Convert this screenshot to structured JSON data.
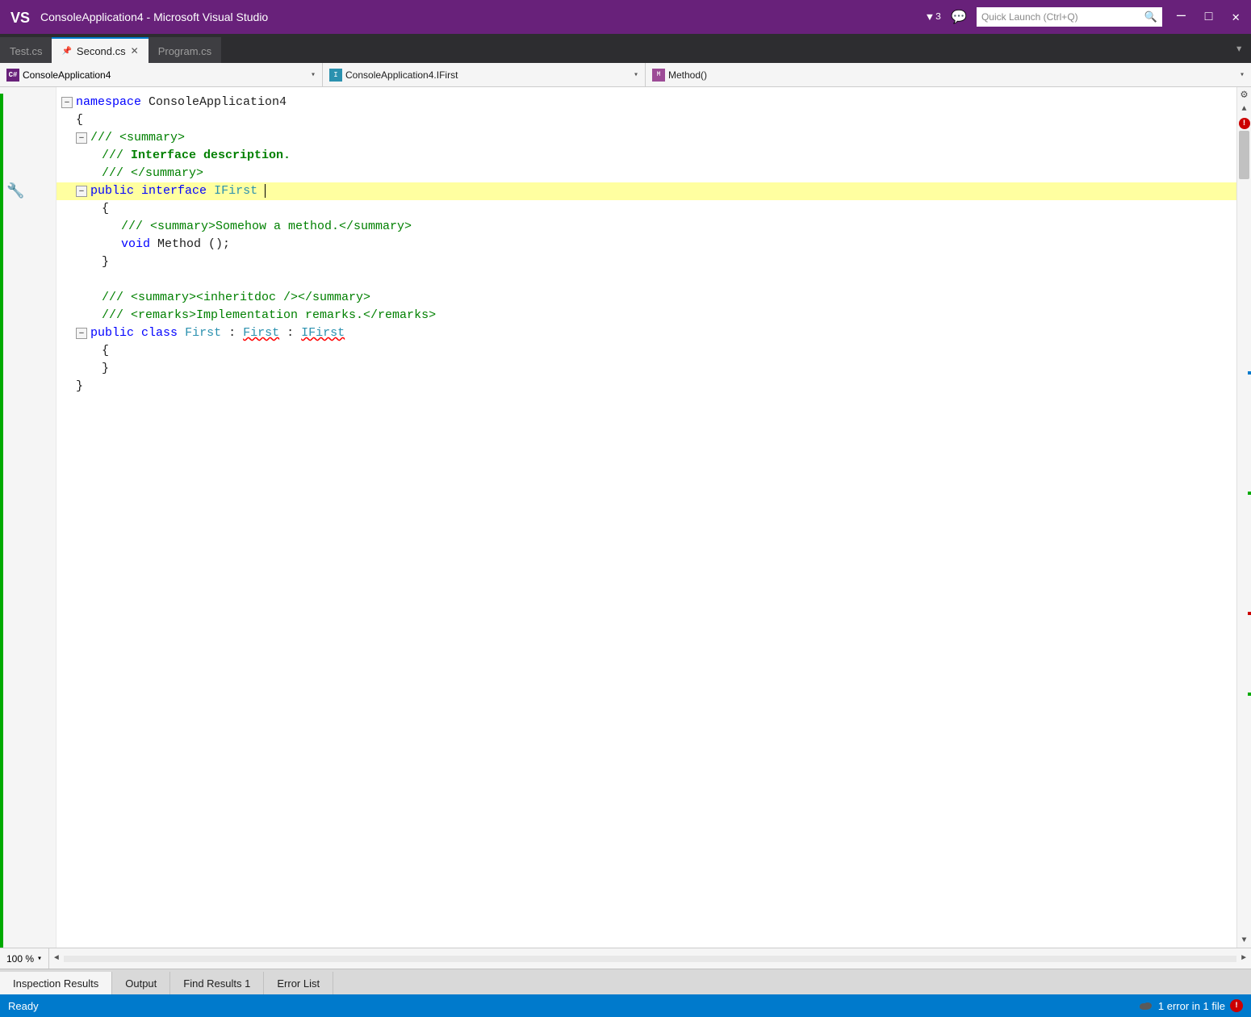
{
  "titlebar": {
    "title": "ConsoleApplication4 - Microsoft Visual Studio",
    "filter_count": "3",
    "search_placeholder": "Quick Launch (Ctrl+Q)"
  },
  "tabs": [
    {
      "label": "Test.cs",
      "active": false,
      "pinned": false,
      "closeable": false
    },
    {
      "label": "Second.cs",
      "active": true,
      "pinned": true,
      "closeable": true
    },
    {
      "label": "Program.cs",
      "active": false,
      "pinned": false,
      "closeable": false
    }
  ],
  "navbar": {
    "project": "ConsoleApplication4",
    "class": "ConsoleApplication4.IFirst",
    "member": "Method()"
  },
  "code": {
    "lines": [
      {
        "num": "",
        "indent": 0,
        "content": "namespace ConsoleApplication4",
        "type": "namespace"
      },
      {
        "num": "",
        "indent": 0,
        "content": "{",
        "type": "plain"
      },
      {
        "num": "",
        "indent": 1,
        "content": "/// <summary>",
        "type": "comment"
      },
      {
        "num": "",
        "indent": 1,
        "content": "/// Interface description.",
        "type": "comment"
      },
      {
        "num": "",
        "indent": 1,
        "content": "/// </summary>",
        "type": "comment"
      },
      {
        "num": "",
        "indent": 1,
        "content": "public interface IFirst",
        "type": "interface",
        "highlight": true
      },
      {
        "num": "",
        "indent": 1,
        "content": "{",
        "type": "plain"
      },
      {
        "num": "",
        "indent": 2,
        "content": "/// <summary>Somehow a method.</summary>",
        "type": "comment"
      },
      {
        "num": "",
        "indent": 2,
        "content": "void Method ();",
        "type": "method"
      },
      {
        "num": "",
        "indent": 1,
        "content": "}",
        "type": "plain"
      },
      {
        "num": "",
        "indent": 0,
        "content": "",
        "type": "plain"
      },
      {
        "num": "",
        "indent": 1,
        "content": "/// <summary><inheritdoc /></summary>",
        "type": "comment"
      },
      {
        "num": "",
        "indent": 1,
        "content": "/// <remarks>Implementation remarks.</remarks>",
        "type": "comment"
      },
      {
        "num": "",
        "indent": 1,
        "content": "public class First : IFirst",
        "type": "class"
      },
      {
        "num": "",
        "indent": 1,
        "content": "{",
        "type": "plain"
      },
      {
        "num": "",
        "indent": 1,
        "content": "}",
        "type": "plain"
      },
      {
        "num": "",
        "indent": 0,
        "content": "}",
        "type": "plain"
      }
    ]
  },
  "bottom_bar": {
    "zoom": "100 %"
  },
  "panel_tabs": [
    {
      "label": "Inspection Results",
      "active": true
    },
    {
      "label": "Output",
      "active": false
    },
    {
      "label": "Find Results 1",
      "active": false
    },
    {
      "label": "Error List",
      "active": false
    }
  ],
  "status_bar": {
    "ready": "Ready",
    "error_text": "1 error in 1 file"
  },
  "icons": {
    "vs_logo": "VS",
    "filter": "▼",
    "chat": "💬",
    "search": "🔍",
    "minimize": "─",
    "maximize": "□",
    "close": "✕",
    "collapse": "─",
    "expand": "+",
    "dropdown": "▾",
    "scroll_up": "▲",
    "scroll_down": "▼",
    "scroll_left": "◄",
    "scroll_right": "►"
  }
}
